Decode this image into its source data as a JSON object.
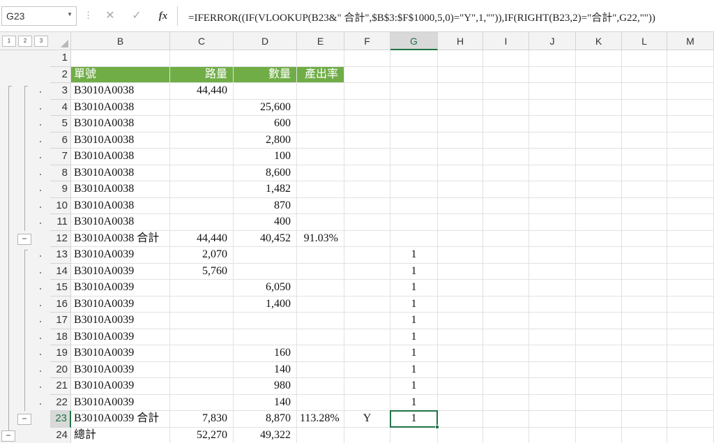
{
  "name_box": "G23",
  "formula_bar": {
    "cancel_icon": "x-icon",
    "enter_icon": "check-icon",
    "fx_label": "fx",
    "formula": "=IFERROR((IF(VLOOKUP(B23&\" 合計\",$B$3:$F$1000,5,0)=\"Y\",1,\"\")),IF(RIGHT(B23,2)=\"合計\",G22,\"\"))"
  },
  "outline_levels": [
    "1",
    "2",
    "3"
  ],
  "outline_collapse_symbol": "−",
  "columns": [
    "B",
    "C",
    "D",
    "E",
    "F",
    "G",
    "H",
    "I",
    "J",
    "K",
    "L",
    "M"
  ],
  "selected_column": "G",
  "selected_row": "23",
  "selected_cell": "G23",
  "header_fill_color": "#70ad47",
  "accent_color": "#217346",
  "rows": [
    {
      "n": "1",
      "B": "",
      "C": "",
      "D": "",
      "E": "",
      "F": "",
      "G": ""
    },
    {
      "n": "2",
      "B": "單號",
      "C": "路量",
      "D": "數量",
      "E": "產出率",
      "F": "",
      "G": "",
      "header": true
    },
    {
      "n": "3",
      "B": "B3010A0038",
      "C": "44,440",
      "D": "",
      "E": "",
      "F": "",
      "G": ""
    },
    {
      "n": "4",
      "B": "B3010A0038",
      "C": "",
      "D": "25,600",
      "E": "",
      "F": "",
      "G": ""
    },
    {
      "n": "5",
      "B": "B3010A0038",
      "C": "",
      "D": "600",
      "E": "",
      "F": "",
      "G": ""
    },
    {
      "n": "6",
      "B": "B3010A0038",
      "C": "",
      "D": "2,800",
      "E": "",
      "F": "",
      "G": ""
    },
    {
      "n": "7",
      "B": "B3010A0038",
      "C": "",
      "D": "100",
      "E": "",
      "F": "",
      "G": ""
    },
    {
      "n": "8",
      "B": "B3010A0038",
      "C": "",
      "D": "8,600",
      "E": "",
      "F": "",
      "G": ""
    },
    {
      "n": "9",
      "B": "B3010A0038",
      "C": "",
      "D": "1,482",
      "E": "",
      "F": "",
      "G": ""
    },
    {
      "n": "10",
      "B": "B3010A0038",
      "C": "",
      "D": "870",
      "E": "",
      "F": "",
      "G": ""
    },
    {
      "n": "11",
      "B": "B3010A0038",
      "C": "",
      "D": "400",
      "E": "",
      "F": "",
      "G": ""
    },
    {
      "n": "12",
      "B": "B3010A0038 合計",
      "C": "44,440",
      "D": "40,452",
      "E": "91.03%",
      "F": "",
      "G": ""
    },
    {
      "n": "13",
      "B": "B3010A0039",
      "C": "2,070",
      "D": "",
      "E": "",
      "F": "",
      "G": "1"
    },
    {
      "n": "14",
      "B": "B3010A0039",
      "C": "5,760",
      "D": "",
      "E": "",
      "F": "",
      "G": "1"
    },
    {
      "n": "15",
      "B": "B3010A0039",
      "C": "",
      "D": "6,050",
      "E": "",
      "F": "",
      "G": "1"
    },
    {
      "n": "16",
      "B": "B3010A0039",
      "C": "",
      "D": "1,400",
      "E": "",
      "F": "",
      "G": "1"
    },
    {
      "n": "17",
      "B": "B3010A0039",
      "C": "",
      "D": "",
      "E": "",
      "F": "",
      "G": "1"
    },
    {
      "n": "18",
      "B": "B3010A0039",
      "C": "",
      "D": "",
      "E": "",
      "F": "",
      "G": "1"
    },
    {
      "n": "19",
      "B": "B3010A0039",
      "C": "",
      "D": "160",
      "E": "",
      "F": "",
      "G": "1"
    },
    {
      "n": "20",
      "B": "B3010A0039",
      "C": "",
      "D": "140",
      "E": "",
      "F": "",
      "G": "1"
    },
    {
      "n": "21",
      "B": "B3010A0039",
      "C": "",
      "D": "980",
      "E": "",
      "F": "",
      "G": "1"
    },
    {
      "n": "22",
      "B": "B3010A0039",
      "C": "",
      "D": "140",
      "E": "",
      "F": "",
      "G": "1"
    },
    {
      "n": "23",
      "B": "B3010A0039 合計",
      "C": "7,830",
      "D": "8,870",
      "E": "113.28%",
      "F": "Y",
      "G": "1"
    },
    {
      "n": "24",
      "B": "總計",
      "C": "52,270",
      "D": "49,322",
      "E": "",
      "F": "",
      "G": ""
    }
  ]
}
